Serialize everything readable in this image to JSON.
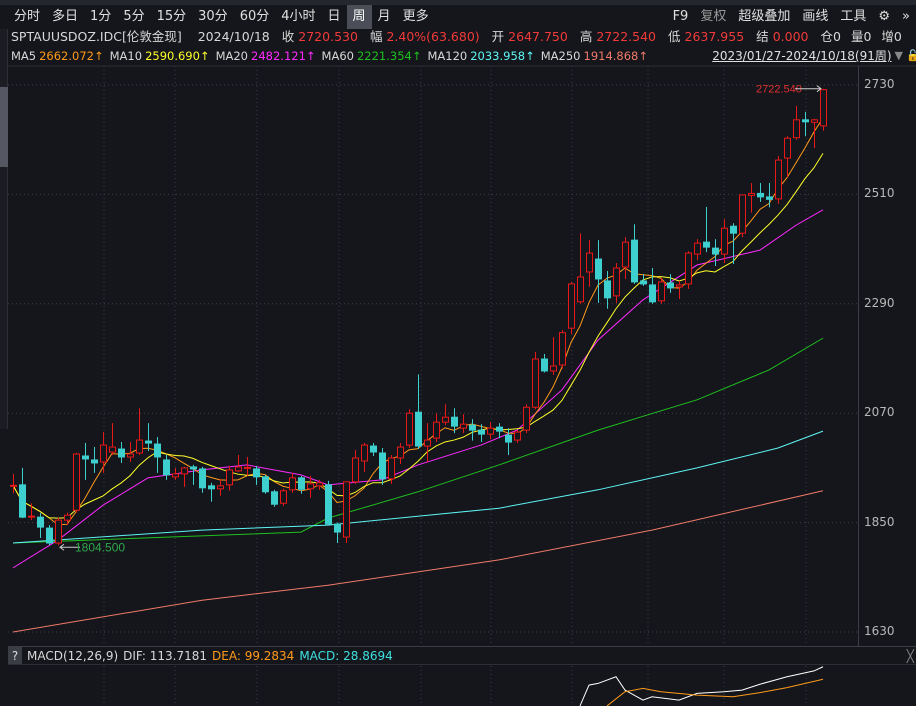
{
  "toolbar": {
    "periods": [
      "分时",
      "多日",
      "1分",
      "5分",
      "15分",
      "30分",
      "60分",
      "4小时",
      "日",
      "周",
      "月",
      "更多"
    ],
    "active": "周",
    "right": [
      "F9",
      "复权",
      "超级叠加",
      "画线",
      "工具"
    ],
    "gear_icon": "gear-icon",
    "more_icon": "double-chevron-right-icon"
  },
  "info": {
    "symbol": "SPTAUUSDOZ.IDC[伦敦金现]",
    "date": "2024/10/18",
    "close_label": "收",
    "close": "2720.530",
    "change_label": "幅",
    "change": "2.40%(63.680)",
    "open_label": "开",
    "open": "2647.750",
    "high_label": "高",
    "high": "2722.540",
    "low_label": "低",
    "low": "2637.955",
    "settle_label": "结",
    "settle": "0.000",
    "pos_label": "仓0",
    "vol_label": "量0",
    "inc_label": "增0"
  },
  "ma": {
    "items": [
      {
        "label": "MA5",
        "value": "2662.072↑",
        "color": "#ff9a1a"
      },
      {
        "label": "MA10",
        "value": "2590.690↑",
        "color": "#ffff2a"
      },
      {
        "label": "MA20",
        "value": "2482.121↑",
        "color": "#ff2aff"
      },
      {
        "label": "MA60",
        "value": "2221.354↑",
        "color": "#1fbf1f"
      },
      {
        "label": "MA120",
        "value": "2033.958↑",
        "color": "#5ff5f5"
      },
      {
        "label": "MA250",
        "value": "1914.868↑",
        "color": "#f07a6a"
      }
    ],
    "range": "2023/01/27-2024/10/18(91周)"
  },
  "chart_data": {
    "type": "candlestick",
    "yticks": [
      2730,
      2510,
      2290,
      2070,
      1850,
      1630
    ],
    "ylim": [
      1610,
      2768
    ],
    "up_color": "#e81818",
    "down_color": "#3ecfcf",
    "high_label": "2722.540",
    "low_label": "1804.500",
    "low_index": 5,
    "ohlc": [
      [
        1924,
        1948,
        1909,
        1925
      ],
      [
        1926,
        1960,
        1859,
        1861
      ],
      [
        1862,
        1889,
        1855,
        1863
      ],
      [
        1861,
        1869,
        1819,
        1841
      ],
      [
        1839,
        1845,
        1805,
        1809
      ],
      [
        1809,
        1860,
        1804.5,
        1855
      ],
      [
        1855,
        1870,
        1845,
        1865
      ],
      [
        1875,
        1990,
        1870,
        1988
      ],
      [
        1984,
        2010,
        1936,
        1978
      ],
      [
        1976,
        2002,
        1950,
        1970
      ],
      [
        1972,
        2032,
        1950,
        2006
      ],
      [
        1992,
        2050,
        1986,
        2002
      ],
      [
        1998,
        2012,
        1970,
        1982
      ],
      [
        1982,
        2012,
        1972,
        1988
      ],
      [
        1990,
        2080,
        1986,
        2016
      ],
      [
        2014,
        2050,
        1994,
        2010
      ],
      [
        2008,
        2022,
        1950,
        1982
      ],
      [
        1976,
        1986,
        1936,
        1946
      ],
      [
        1942,
        1960,
        1936,
        1948
      ],
      [
        1948,
        1962,
        1922,
        1960
      ],
      [
        1962,
        1966,
        1926,
        1958
      ],
      [
        1958,
        1962,
        1910,
        1920
      ],
      [
        1924,
        1930,
        1892,
        1918
      ],
      [
        1918,
        1938,
        1904,
        1924
      ],
      [
        1926,
        1964,
        1914,
        1956
      ],
      [
        1954,
        1986,
        1952,
        1962
      ],
      [
        1960,
        1982,
        1944,
        1961
      ],
      [
        1958,
        1964,
        1926,
        1942
      ],
      [
        1942,
        1946,
        1908,
        1912
      ],
      [
        1912,
        1916,
        1882,
        1887
      ],
      [
        1889,
        1918,
        1884,
        1914
      ],
      [
        1916,
        1950,
        1910,
        1940
      ],
      [
        1940,
        1944,
        1908,
        1917
      ],
      [
        1918,
        1944,
        1900,
        1928
      ],
      [
        1924,
        1936,
        1916,
        1930
      ],
      [
        1926,
        1934,
        1845,
        1847
      ],
      [
        1847,
        1850,
        1809,
        1831
      ],
      [
        1821,
        1932,
        1809,
        1932
      ],
      [
        1932,
        1996,
        1928,
        1980
      ],
      [
        1974,
        2010,
        1952,
        2006
      ],
      [
        2004,
        2010,
        1984,
        1992
      ],
      [
        1990,
        2000,
        1926,
        1938
      ],
      [
        1938,
        1986,
        1928,
        1980
      ],
      [
        1980,
        2010,
        1968,
        2002
      ],
      [
        2006,
        2078,
        2000,
        2070
      ],
      [
        2072,
        2148,
        1998,
        2004
      ],
      [
        2004,
        2050,
        1972,
        2016
      ],
      [
        2020,
        2070,
        2012,
        2052
      ],
      [
        2052,
        2088,
        2046,
        2062
      ],
      [
        2062,
        2080,
        2030,
        2044
      ],
      [
        2040,
        2068,
        2030,
        2048
      ],
      [
        2046,
        2058,
        2015,
        2036
      ],
      [
        2036,
        2048,
        2012,
        2028
      ],
      [
        2028,
        2052,
        2018,
        2040
      ],
      [
        2042,
        2050,
        2020,
        2034
      ],
      [
        2026,
        2040,
        1986,
        2012
      ],
      [
        2016,
        2036,
        2010,
        2032
      ],
      [
        2036,
        2088,
        2030,
        2082
      ],
      [
        2082,
        2193,
        2078,
        2179
      ],
      [
        2179,
        2189,
        2152,
        2155
      ],
      [
        2155,
        2223,
        2147,
        2165
      ],
      [
        2167,
        2237,
        2160,
        2232
      ],
      [
        2241,
        2334,
        2229,
        2330
      ],
      [
        2294,
        2432,
        2290,
        2344
      ],
      [
        2354,
        2418,
        2324,
        2392
      ],
      [
        2380,
        2418,
        2292,
        2340
      ],
      [
        2336,
        2356,
        2280,
        2302
      ],
      [
        2306,
        2372,
        2292,
        2362
      ],
      [
        2364,
        2424,
        2340,
        2414
      ],
      [
        2418,
        2450,
        2330,
        2334
      ],
      [
        2336,
        2350,
        2326,
        2330
      ],
      [
        2328,
        2362,
        2290,
        2294
      ],
      [
        2296,
        2342,
        2290,
        2334
      ],
      [
        2332,
        2350,
        2312,
        2322
      ],
      [
        2324,
        2336,
        2300,
        2328
      ],
      [
        2330,
        2396,
        2320,
        2392
      ],
      [
        2390,
        2420,
        2378,
        2412
      ],
      [
        2414,
        2485,
        2394,
        2404
      ],
      [
        2402,
        2420,
        2366,
        2390
      ],
      [
        2390,
        2460,
        2372,
        2442
      ],
      [
        2446,
        2452,
        2370,
        2432
      ],
      [
        2432,
        2510,
        2424,
        2509
      ],
      [
        2508,
        2533,
        2473,
        2512
      ],
      [
        2512,
        2533,
        2495,
        2505
      ],
      [
        2505,
        2533,
        2484,
        2500
      ],
      [
        2501,
        2587,
        2491,
        2579
      ],
      [
        2583,
        2627,
        2545,
        2623
      ],
      [
        2624,
        2688,
        2620,
        2660
      ],
      [
        2660,
        2676,
        2627,
        2656
      ],
      [
        2655,
        2662,
        2603,
        2660
      ],
      [
        2647.75,
        2722.54,
        2637.955,
        2720.53
      ]
    ],
    "ma_series": [
      {
        "name": "MA20",
        "color": "#ff2aff",
        "points": [
          [
            0,
            1759
          ],
          [
            5,
            1815
          ],
          [
            10,
            1885
          ],
          [
            15,
            1940
          ],
          [
            21,
            1956
          ],
          [
            26,
            1966
          ],
          [
            32,
            1946
          ],
          [
            35,
            1926
          ],
          [
            41,
            1936
          ],
          [
            45,
            1966
          ],
          [
            52,
            2006
          ],
          [
            56,
            2036
          ],
          [
            61,
            2117
          ],
          [
            65,
            2217
          ],
          [
            70,
            2298
          ],
          [
            76,
            2368
          ],
          [
            83,
            2398
          ],
          [
            87,
            2448
          ],
          [
            90,
            2479
          ]
        ]
      },
      {
        "name": "MA60",
        "color": "#1fbf1f",
        "points": [
          [
            0,
            1809
          ],
          [
            32,
            1831
          ],
          [
            35,
            1859
          ],
          [
            45,
            1912
          ],
          [
            54,
            1966
          ],
          [
            65,
            2036
          ],
          [
            76,
            2097
          ],
          [
            84,
            2157
          ],
          [
            90,
            2221
          ]
        ]
      },
      {
        "name": "MA120",
        "color": "#5ff5f5",
        "points": [
          [
            0,
            1809
          ],
          [
            21,
            1835
          ],
          [
            35,
            1845
          ],
          [
            54,
            1879
          ],
          [
            65,
            1916
          ],
          [
            76,
            1960
          ],
          [
            85,
            2000
          ],
          [
            90,
            2034
          ]
        ]
      },
      {
        "name": "MA250",
        "color": "#f07a6a",
        "points": [
          [
            0,
            1630
          ],
          [
            21,
            1694
          ],
          [
            35,
            1724
          ],
          [
            54,
            1775
          ],
          [
            71,
            1835
          ],
          [
            90,
            1914
          ]
        ]
      }
    ]
  },
  "macd": {
    "help": "?",
    "title": "MACD(12,26,9)",
    "dif": "DIF: 113.7181",
    "dea": "DEA: 99.2834",
    "macd": "MACD: 28.8694",
    "dea_color": "#ff9a1a",
    "macd_color": "#3ee0e0",
    "dif_points": [
      [
        63,
        67
      ],
      [
        64,
        92
      ],
      [
        65,
        94
      ],
      [
        67,
        102
      ],
      [
        68,
        86
      ],
      [
        70,
        74
      ],
      [
        71,
        78
      ],
      [
        74,
        74
      ],
      [
        76,
        82
      ],
      [
        79,
        84
      ],
      [
        81,
        86
      ],
      [
        83,
        93
      ],
      [
        86,
        102
      ],
      [
        89,
        109
      ],
      [
        90,
        114
      ]
    ],
    "dea_points": [
      [
        66,
        67
      ],
      [
        68,
        84
      ],
      [
        70,
        88
      ],
      [
        72,
        84
      ],
      [
        76,
        80
      ],
      [
        80,
        78
      ],
      [
        83,
        83
      ],
      [
        86,
        89
      ],
      [
        90,
        99
      ]
    ]
  }
}
